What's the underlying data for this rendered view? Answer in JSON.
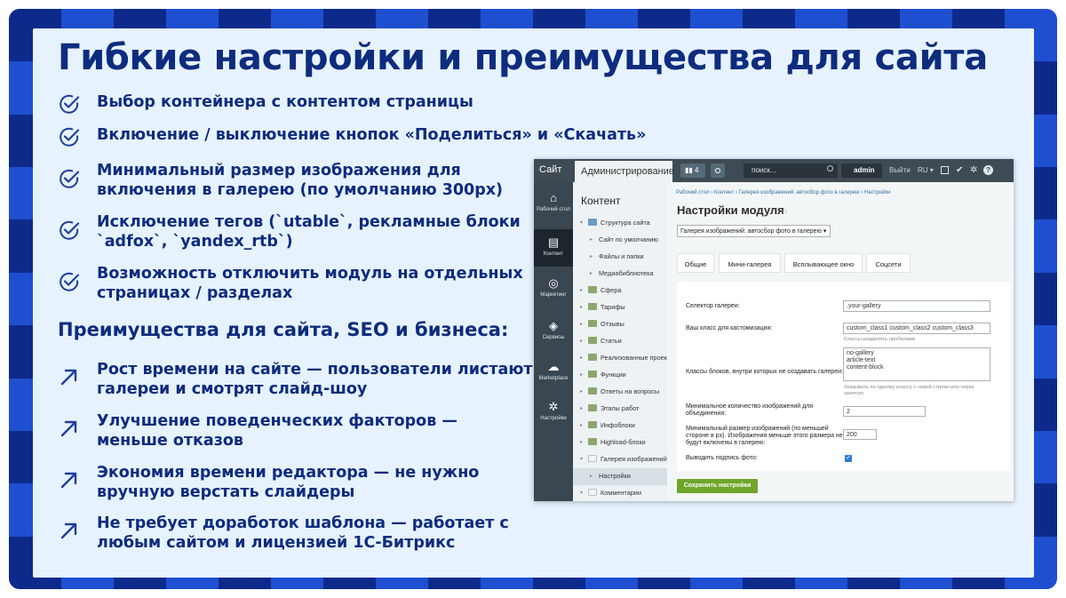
{
  "title": "Гибкие настройки и преимущества для сайта",
  "features": [
    {
      "text": "Выбор контейнера с контентом страницы",
      "icon": "check-circle-icon"
    },
    {
      "text": "Включение / выключение кнопок «Поделиться» и «Скачать»",
      "icon": "check-circle-icon"
    },
    {
      "text": "Минимальный размер изображения для",
      "text2": "включения в галерею (по умолчанию 300px)",
      "icon": "check-circle-icon"
    },
    {
      "text": "Исключение тегов (`utable`, рекламные блоки",
      "text2": "`adfox`, `yandex_rtb`)",
      "icon": "check-circle-icon"
    },
    {
      "text": "Возможность отключить модуль на отдельных",
      "text2": "страницах / разделах",
      "icon": "check-circle-icon"
    }
  ],
  "benefits_title": "Преимущества для сайта, SEO и бизнеса:",
  "benefits": [
    {
      "text": "Рост времени на сайте — пользователи листают",
      "text2": "галереи и смотрят слайд-шоу",
      "icon": "arrow-up-right-icon"
    },
    {
      "text": "Улучшение поведенческих факторов —",
      "text2": "меньше отказов",
      "icon": "arrow-up-right-icon"
    },
    {
      "text": "Экономия времени редактора — не нужно",
      "text2": "вручную верстать слайдеры",
      "icon": "arrow-up-right-icon"
    },
    {
      "text": "Не требует доработок шаблона — работает с",
      "text2": "любым сайтом и лицензией 1С-Битрикс",
      "icon": "arrow-up-right-icon"
    }
  ],
  "colors": {
    "accent": "#0e2c7e",
    "frame_dark": "#0d2a8a",
    "frame_light": "#1f4fd1",
    "background": "#e6f2fd"
  },
  "admin": {
    "topbar": {
      "site": "Сайт",
      "administration": "Администрирование",
      "badge": "4",
      "search_placeholder": "поиск...",
      "user": "admin",
      "exit": "Выйти",
      "lang": "RU"
    },
    "leftbar": [
      {
        "label": "Рабочий стол",
        "icon": "home-icon"
      },
      {
        "label": "Контент",
        "icon": "content-icon"
      },
      {
        "label": "Маркетинг",
        "icon": "target-icon"
      },
      {
        "label": "Сервисы",
        "icon": "layers-icon"
      },
      {
        "label": "Marketplace",
        "icon": "cloud-download-icon"
      },
      {
        "label": "Настройки",
        "icon": "gear-icon"
      }
    ],
    "tree_title": "Контент",
    "tree": [
      {
        "label": "Структура сайта"
      },
      {
        "label": "Сайт по умолчанию"
      },
      {
        "label": "Файлы и папки"
      },
      {
        "label": "Медиабиблиотека"
      },
      {
        "label": "Сфера"
      },
      {
        "label": "Тарифы"
      },
      {
        "label": "Отзывы"
      },
      {
        "label": "Статьи"
      },
      {
        "label": "Реализованные проекты"
      },
      {
        "label": "Функции"
      },
      {
        "label": "Ответы на вопросы"
      },
      {
        "label": "Этапы работ"
      },
      {
        "label": "Инфоблоки"
      },
      {
        "label": "Highload-блоки"
      },
      {
        "label": "Галерея изображений: автосбор"
      },
      {
        "label": "Настройки"
      },
      {
        "label": "Комментарии"
      }
    ],
    "breadcrumbs": "Рабочий стол  ›  Контент  ›  Галерея изображений: автосбор фото в галерею  ›  Настройки",
    "page_title": "Настройки модуля",
    "module_select": "Галерея изображений: автосбор фото в галерею",
    "tabs": [
      "Общие",
      "Мини-галерея",
      "Всплывающее окно",
      "Соцсети"
    ],
    "fields": {
      "gallery_selector_label": "Селектор галереи:",
      "gallery_selector_value": ".your-gallery",
      "custom_class_label": "Ваш класс для кастомизации:",
      "custom_class_value": "custom_class1 custom_class2 custom_class3",
      "custom_class_hint": "Классы разделять пробелами",
      "exclude_label": "Классы блоков, внутри которых не создавать галереи:",
      "exclude_value_1": "no-gallery",
      "exclude_value_2": "article-text",
      "exclude_value_3": "content-block",
      "exclude_hint_1": "Указывать по одному классу с новой строки или через",
      "exclude_hint_2": "запятую",
      "min_count_label_1": "Минимальное количество изображений для",
      "min_count_label_2": "объединения:",
      "min_count_value": "2",
      "min_size_label_1": "Минимальный размер изображений (по меньшей",
      "min_size_label_2": "стороне в px). Изображения меньше этого размера не",
      "min_size_label_3": "будут включены в галерею:",
      "min_size_value": "200",
      "caption_label": "Выводить подпись фото:"
    },
    "save_button": "Сохранить настройки"
  }
}
